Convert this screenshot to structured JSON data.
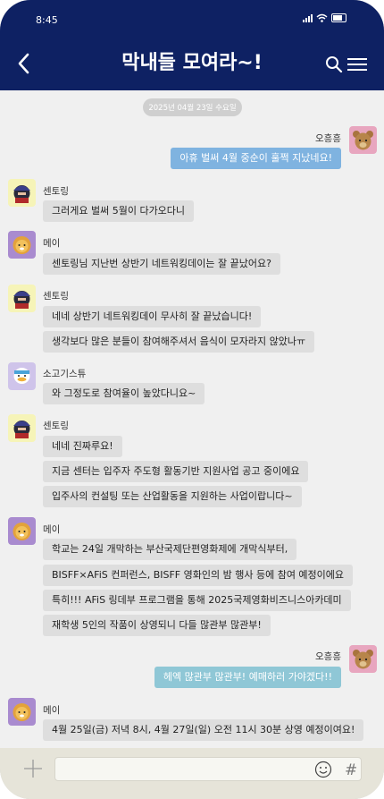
{
  "status_bar": {
    "time": "8:45"
  },
  "header": {
    "title": "막내들 모여라~!"
  },
  "date_divider": "2025년 04월 23일 수요일",
  "messages": [
    {
      "sender": "오흥흥",
      "text": "아휴 벌써 4월 중순이 훌쩍 지났네요!"
    },
    {
      "sender": "센토링",
      "text": "그러게요 벌써 5월이 다가오다니"
    },
    {
      "sender": "메이",
      "text": "센토링님 지난번 상반기 네트워킹데이는 잘 끝났어요?"
    },
    {
      "sender": "센토링",
      "text": "네네 상반기 네트워킹데이 무사히 잘 끝났습니다!"
    },
    {
      "sender": "센토링",
      "text": "생각보다 많은 분들이 참여해주셔서 음식이 모자라지 않았나ㅠ"
    },
    {
      "sender": "소고기스튜",
      "text": "와 그정도로 참여율이 높았다니요~"
    },
    {
      "sender": "센토링",
      "text": "네네 진짜루요!"
    },
    {
      "sender": "센토링",
      "text": "지금 센터는 입주자 주도형 활동기반 지원사업 공고 중이에요"
    },
    {
      "sender": "센토링",
      "text": "입주사의 컨설팅 또는 산업활동을 지원하는 사업이랍니다~"
    },
    {
      "sender": "메이",
      "text": "학교는 24일 개막하는 부산국제단편영화제에 개막식부터,"
    },
    {
      "sender": "메이",
      "text": "BISFF×AFiS 컨퍼런스, BISFF 영화인의 밤 행사 등에 참여 예정이에요"
    },
    {
      "sender": "메이",
      "text": "특히!!! AFiS 링데부 프로그램을 통해 2025국제영화비즈니스아카데미"
    },
    {
      "sender": "메이",
      "text": "재학생 5인의 작품이 상영되니 다들 많관부 많관부!"
    },
    {
      "sender": "오흥흥",
      "text": "헤엑 많관부 많관부! 예매하러 가야겠다!!"
    },
    {
      "sender": "메이",
      "text": "4월 25일(금) 저녁 8시, 4월 27일(일) 오전 11시 30분 상영 예정이여요!"
    }
  ],
  "input": {
    "placeholder": ""
  },
  "colors": {
    "header_bg": "#0e2163",
    "outgoing_bubble": "#7fb3e0",
    "incoming_bubble": "#dedede",
    "chat_bg": "#f0f0f0"
  },
  "icons": [
    "back-arrow-icon",
    "search-icon",
    "hamburger-menu-icon",
    "plus-icon",
    "emoji-icon",
    "hash-icon"
  ]
}
